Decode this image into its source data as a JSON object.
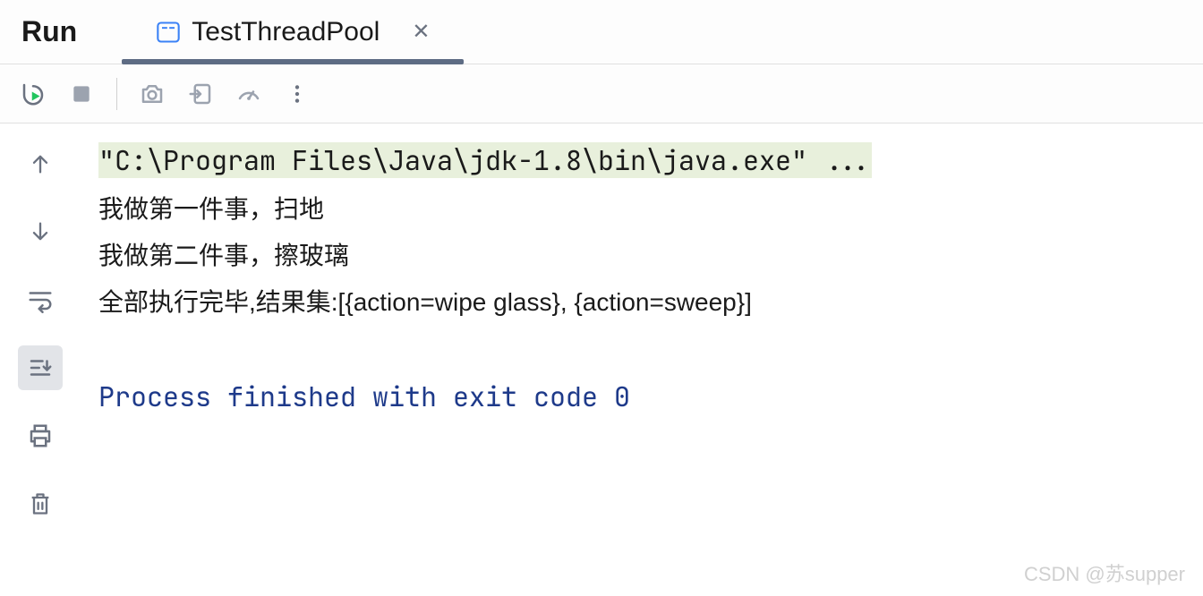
{
  "header": {
    "title": "Run",
    "tab": {
      "label": "TestThreadPool"
    }
  },
  "console": {
    "command": "\"C:\\Program Files\\Java\\jdk-1.8\\bin\\java.exe\" ...",
    "lines": [
      "我做第一件事，扫地",
      "我做第二件事，擦玻璃",
      "全部执行完毕,结果集:[{action=wipe glass}, {action=sweep}]"
    ],
    "exit": "Process finished with exit code 0"
  },
  "watermark": "CSDN @苏supper"
}
